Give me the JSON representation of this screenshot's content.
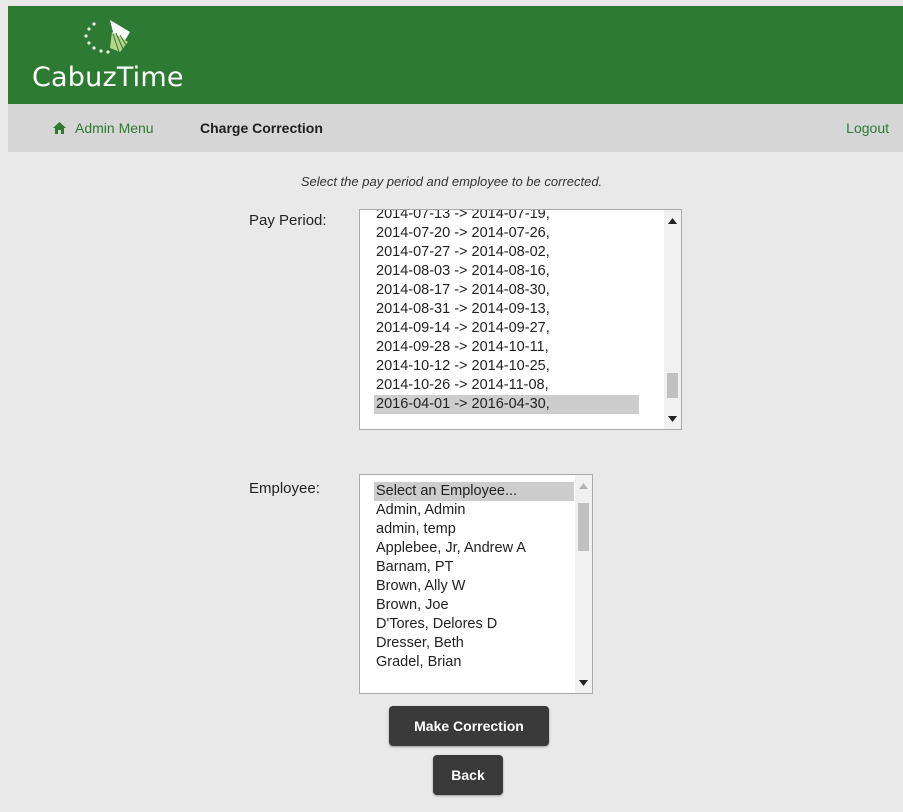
{
  "app": {
    "name": "CabuzTime"
  },
  "nav": {
    "admin_menu": "Admin Menu",
    "current": "Charge Correction",
    "logout": "Logout"
  },
  "form": {
    "instructions": "Select the pay period and employee to be corrected.",
    "pay_period_label": "Pay Period:",
    "pay_periods": [
      "2014-07-13 -> 2014-07-19,",
      "2014-07-20 -> 2014-07-26,",
      "2014-07-27 -> 2014-08-02,",
      "2014-08-03 -> 2014-08-16,",
      "2014-08-17 -> 2014-08-30,",
      "2014-08-31 -> 2014-09-13,",
      "2014-09-14 -> 2014-09-27,",
      "2014-09-28 -> 2014-10-11,",
      "2014-10-12 -> 2014-10-25,",
      "2014-10-26 -> 2014-11-08,",
      "2016-04-01 -> 2016-04-30,"
    ],
    "pay_period_selected": "2016-04-01 -> 2016-04-30,",
    "employee_label": "Employee:",
    "employees": [
      "Select an Employee...",
      "Admin, Admin",
      "admin, temp",
      "Applebee, Jr, Andrew A",
      "Barnam, PT",
      "Brown, Ally W",
      "Brown, Joe",
      "D'Tores, Delores D",
      "Dresser, Beth",
      "Gradel, Brian"
    ],
    "employee_selected": "Select an Employee...",
    "make_correction": "Make Correction",
    "back": "Back"
  },
  "colors": {
    "brand_green": "#2d7a33",
    "nav_bg": "#d6d6d6",
    "page_bg": "#e9e9e9",
    "button_bg": "#3a3a3a"
  },
  "icons": {
    "home": "home-icon",
    "logo": "logo-mark-icon"
  }
}
